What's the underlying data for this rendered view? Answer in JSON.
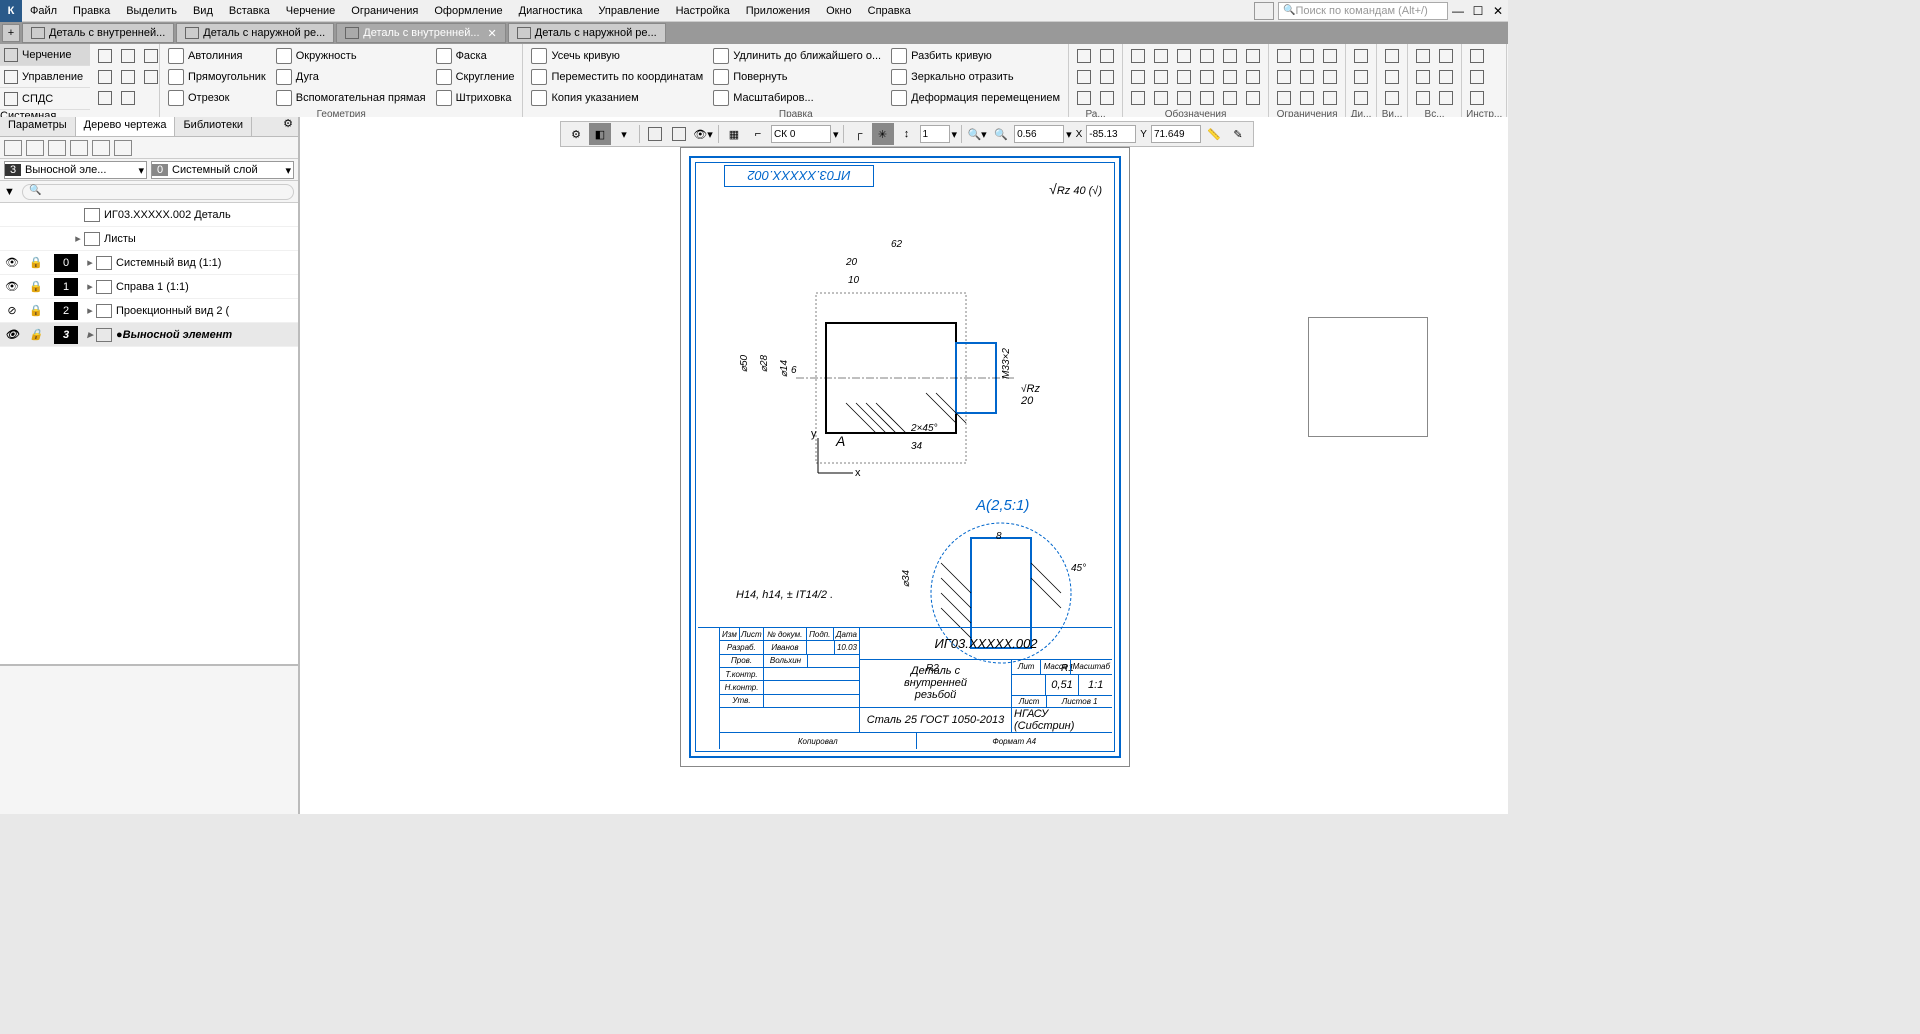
{
  "menu": {
    "items": [
      "Файл",
      "Правка",
      "Выделить",
      "Вид",
      "Вставка",
      "Черчение",
      "Ограничения",
      "Оформление",
      "Диагностика",
      "Управление",
      "Настройка",
      "Приложения",
      "Окно",
      "Справка"
    ],
    "search_placeholder": "Поиск по командам (Alt+/)"
  },
  "doc_tabs": [
    {
      "label": "Деталь с внутренней...",
      "active": false
    },
    {
      "label": "Деталь с наружной ре...",
      "active": false
    },
    {
      "label": "Деталь с внутренней...",
      "active": true
    },
    {
      "label": "Деталь с наружной ре...",
      "active": false
    }
  ],
  "context_tabs": [
    {
      "label": "Черчение",
      "active": true
    },
    {
      "label": "Управление",
      "active": false
    },
    {
      "label": "СПДС",
      "active": false
    }
  ],
  "ribbon": {
    "system_label": "Системная",
    "geometry": {
      "label": "Геометрия",
      "autoline": "Автолиния",
      "rect": "Прямоугольник",
      "segment": "Отрезок",
      "circle": "Окружность",
      "arc": "Дуга",
      "auxline": "Вспомогательная прямая",
      "chamfer": "Фаска",
      "fillet": "Скругление",
      "hatch": "Штриховка"
    },
    "edit": {
      "label": "Правка",
      "trim": "Усечь кривую",
      "move": "Переместить по координатам",
      "copy": "Копия указанием",
      "extend": "Удлинить до ближайшего о...",
      "rotate": "Повернуть",
      "scale": "Масштабиров...",
      "split": "Разбить кривую",
      "mirror": "Зеркально отразить",
      "deform": "Деформация перемещением"
    },
    "dims": {
      "label": "Ра..."
    },
    "annot": {
      "label": "Обозначения"
    },
    "constr": {
      "label": "Ограничения"
    },
    "diag": {
      "label": "Ди..."
    },
    "views": {
      "label": "Ви..."
    },
    "insert": {
      "label": "Вс..."
    },
    "tools": {
      "label": "Инстр..."
    }
  },
  "float_tb": {
    "cs_label": "СК 0",
    "step": "1",
    "zoom": "0.56",
    "x_label": "X",
    "x_val": "-85.13",
    "y_label": "Y",
    "y_val": "71.649"
  },
  "panel_tabs": [
    "Параметры",
    "Дерево чертежа",
    "Библиотеки"
  ],
  "panel_active_tab": 1,
  "sel1": {
    "badge": "3",
    "text": "Выносной эле..."
  },
  "sel2": {
    "badge": "0",
    "text": "Системный слой"
  },
  "tree": {
    "root": "ИГ03.XXXXX.002 Деталь",
    "sheets": "Листы",
    "rows": [
      {
        "num": "0",
        "label": "Системный вид (1:1)",
        "vis": "👁",
        "sel": false
      },
      {
        "num": "1",
        "label": "Справа 1 (1:1)",
        "vis": "👁",
        "sel": false
      },
      {
        "num": "2",
        "label": "Проекционный вид 2 (",
        "vis": "⊘",
        "sel": false
      },
      {
        "num": "3",
        "label": "Выносной элемент",
        "vis": "👁",
        "sel": true
      }
    ]
  },
  "drawing": {
    "top_code": "ИГ03.XXXXX.002",
    "surface": "Rz 40 (√)",
    "detail_label": "А(2,5:1)",
    "note": "H14, h14, ± IT14/2 .",
    "tb": {
      "code": "ИГ03.XXXXX.002",
      "name_l1": "Деталь с",
      "name_l2": "внутренней",
      "name_l3": "резьбой",
      "material": "Сталь 25  ГОСТ 1050-2013",
      "org": "НГАСУ (Сибстрин)",
      "lit": "Лит",
      "mass": "Масса",
      "scale": "Масштаб",
      "mass_val": "0,51",
      "scale_val": "1:1",
      "sheet": "Лист",
      "sheets": "Листов  1",
      "copied": "Копировал",
      "format": "Формат   А4",
      "col_izm": "Изм",
      "col_list": "Лист",
      "col_doc": "№ докум.",
      "col_sign": "Подп.",
      "col_date": "Дата",
      "row_razrab": "Разраб.",
      "row_razrab_name": "Иванов",
      "row_razrab_date": "10.03",
      "row_prov": "Пров.",
      "row_prov_name": "Вольхин",
      "row_tkontr": "Т.контр.",
      "row_nkontr": "Н.контр.",
      "row_utv": "Утв."
    },
    "dims": {
      "d62": "62",
      "d20": "20",
      "d10": "10",
      "d50": "⌀50",
      "d28": "⌀28",
      "d14": "⌀14",
      "d6": "6",
      "m33": "M33×2",
      "rz20": "Rz 20",
      "ch245": "2×45°",
      "d34": "34",
      "viewA": "A",
      "d8": "8",
      "d34d": "⌀34",
      "a45": "45°",
      "r1": "R1",
      "r2": "R2"
    }
  }
}
